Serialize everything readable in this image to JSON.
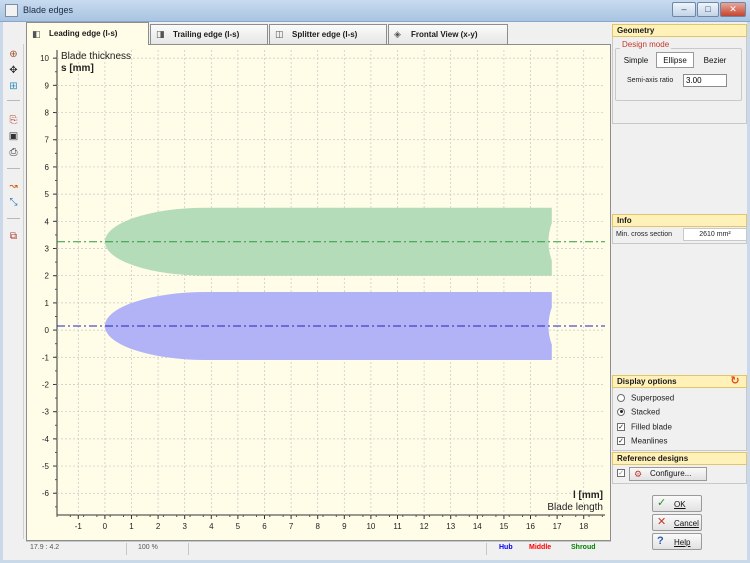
{
  "window": {
    "title": "Blade edges",
    "minimize": "–",
    "maximize": "□",
    "close": "✕"
  },
  "tabs": [
    {
      "label": "Leading edge (l-s)",
      "icon": "leading-edge-icon",
      "active": true
    },
    {
      "label": "Trailing edge (l-s)",
      "icon": "trailing-edge-icon",
      "active": false
    },
    {
      "label": "Splitter edge (l-s)",
      "icon": "splitter-edge-icon",
      "active": false
    },
    {
      "label": "Frontal View (x-y)",
      "icon": "frontal-view-icon",
      "active": false
    }
  ],
  "toolbar": [
    "zoom-icon",
    "pan-icon",
    "fit-icon",
    "export-icon",
    "save-icon",
    "print-icon",
    "curve-icon",
    "pick-icon",
    "copy-icon"
  ],
  "chart_data": {
    "type": "area",
    "ylabel_line1": "Blade thickness",
    "ylabel_line2": "s [mm]",
    "xlabel_line1": "l [mm]",
    "xlabel_line2": "Blade length",
    "xlim": [
      -1.8,
      18.8
    ],
    "ylim": [
      -6.8,
      10.3
    ],
    "xticks": [
      -1,
      0,
      1,
      2,
      3,
      4,
      5,
      6,
      7,
      8,
      9,
      10,
      11,
      12,
      13,
      14,
      15,
      16,
      17,
      18
    ],
    "yticks": [
      10,
      9,
      8,
      7,
      6,
      5,
      4,
      3,
      2,
      1,
      0,
      -1,
      -2,
      -3,
      -4,
      -5,
      -6
    ],
    "grid": true,
    "series": [
      {
        "name": "Shroud",
        "color": "#b5dcb8",
        "meanline_color": "#2e9a40",
        "meanline_y": 3.25,
        "half_thickness": 1.25,
        "le_start_x": 0.0,
        "le_end_x": 3.8,
        "te_x": 16.8
      },
      {
        "name": "Hub",
        "color": "#b2b2f7",
        "meanline_color": "#2222bb",
        "meanline_y": 0.15,
        "half_thickness": 1.25,
        "le_start_x": 0.0,
        "le_end_x": 3.8,
        "te_x": 16.8
      }
    ]
  },
  "status": {
    "coords": "17.9 : 4.2",
    "zoom": "100 %",
    "hub": "Hub",
    "middle": "Middle",
    "shroud": "Shroud"
  },
  "geometry": {
    "header": "Geometry",
    "design_mode_label": "Design mode",
    "modes": [
      "Simple",
      "Ellipse",
      "Bezier"
    ],
    "active_mode": "Ellipse",
    "semi_axis_label": "Semi-axis ratio",
    "semi_axis_value": "3.00"
  },
  "info": {
    "header": "Info",
    "min_cross_label": "Min. cross section",
    "min_cross_value": "2610 mm²"
  },
  "display_options": {
    "header": "Display options",
    "superposed": "Superposed",
    "stacked": "Stacked",
    "filled_blade": "Filled blade",
    "meanlines": "Meanlines",
    "selected": "Stacked",
    "filled_checked": true,
    "meanlines_checked": true
  },
  "reference": {
    "header": "Reference designs",
    "configure": "Configure..."
  },
  "buttons": {
    "ok": "OK",
    "cancel": "Cancel",
    "help": "Help"
  }
}
